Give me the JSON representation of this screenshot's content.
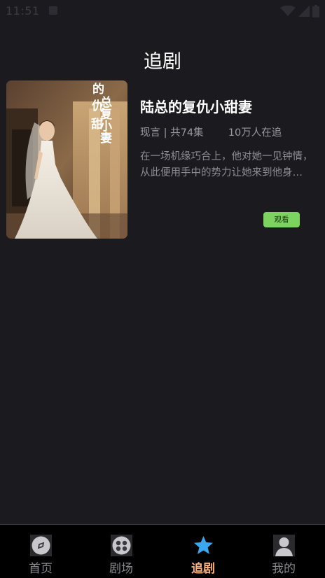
{
  "status_bar": {
    "time": "11:51",
    "icons": [
      "notification-a-icon",
      "wifi-icon",
      "signal-icon",
      "battery-icon"
    ]
  },
  "header": {
    "title": "追剧"
  },
  "drama": {
    "title": "陆总的复仇小甜妻",
    "genre": "现言",
    "episodes": "共74集",
    "followers": "10万人在追",
    "description": "在一场机缘巧合上，他对她一见钟情，从此便用手中的势力让她来到他身边……",
    "watch_label": "观看",
    "poster_icon": "drama-poster"
  },
  "nav": {
    "items": [
      {
        "label": "首页",
        "icon": "compass-icon"
      },
      {
        "label": "剧场",
        "icon": "film-reel-icon"
      },
      {
        "label": "追剧",
        "icon": "star-icon",
        "active": true
      },
      {
        "label": "我的",
        "icon": "user-icon"
      }
    ]
  },
  "colors": {
    "background": "#1b1a1f",
    "accent_active": "#ffb27a",
    "watch_button": "#7cd35f",
    "star": "#3aa7f0"
  }
}
